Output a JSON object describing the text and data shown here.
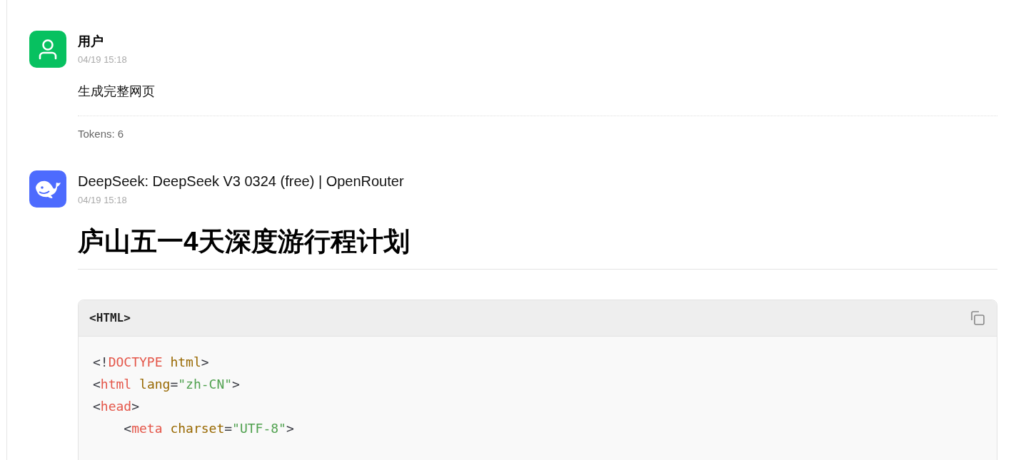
{
  "messages": [
    {
      "kind": "user",
      "author": "用户",
      "time": "04/19 15:18",
      "text": "生成完整网页",
      "tokens": "Tokens: 6"
    },
    {
      "kind": "bot",
      "author": "DeepSeek: DeepSeek V3 0324 (free) | OpenRouter",
      "time": "04/19 15:18",
      "heading": "庐山五一4天深度游行程计划",
      "code": {
        "language": "<HTML>",
        "lines": [
          [
            {
              "text": "<!",
              "kind": "punct"
            },
            {
              "text": "DOCTYPE",
              "kind": "tag"
            },
            {
              "text": " html",
              "kind": "attr"
            },
            {
              "text": ">",
              "kind": "punct"
            }
          ],
          [
            {
              "text": "<",
              "kind": "punct"
            },
            {
              "text": "html",
              "kind": "tag"
            },
            {
              "text": " lang",
              "kind": "attr"
            },
            {
              "text": "=",
              "kind": "punct"
            },
            {
              "text": "\"zh-CN\"",
              "kind": "string"
            },
            {
              "text": ">",
              "kind": "punct"
            }
          ],
          [
            {
              "text": "<",
              "kind": "punct"
            },
            {
              "text": "head",
              "kind": "tag"
            },
            {
              "text": ">",
              "kind": "punct"
            }
          ],
          [
            {
              "text": "    <",
              "kind": "punct"
            },
            {
              "text": "meta",
              "kind": "tag"
            },
            {
              "text": " charset",
              "kind": "attr"
            },
            {
              "text": "=",
              "kind": "punct"
            },
            {
              "text": "\"UTF-8\"",
              "kind": "string"
            },
            {
              "text": ">",
              "kind": "punct"
            }
          ]
        ]
      }
    }
  ]
}
